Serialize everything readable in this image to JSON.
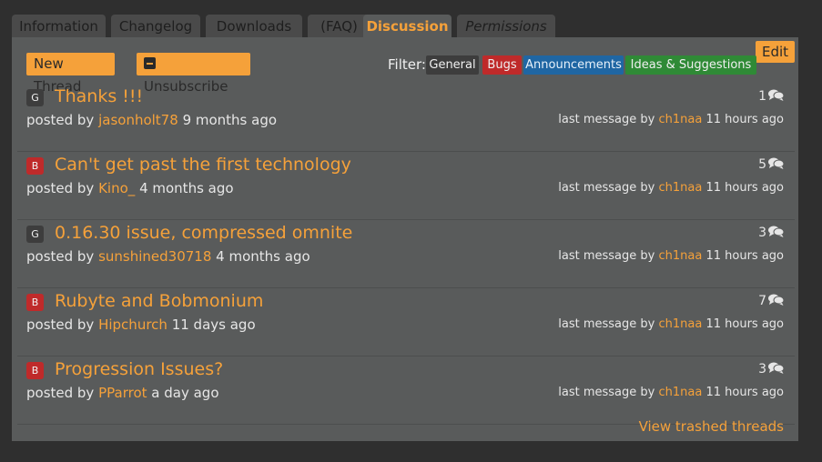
{
  "tabs": [
    {
      "label": "Information"
    },
    {
      "label": "Changelog"
    },
    {
      "label": "Downloads"
    },
    {
      "label": "(FAQ)"
    },
    {
      "label": "Discussion"
    },
    {
      "label": "Permissions"
    }
  ],
  "toolbar": {
    "edit_label": "Edit",
    "new_thread_label": "New Thread",
    "unsubscribe_label": "Unsubscribe",
    "filter_label": "Filter:",
    "filters": [
      "General",
      "Bugs",
      "Announcements",
      "Ideas & Suggestions"
    ]
  },
  "threads": [
    {
      "category": "G",
      "title": "Thanks !!!",
      "posted_prefix": "posted by",
      "author": "jasonholt78",
      "age": "9 months ago",
      "count": "1",
      "last_prefix": "last message by",
      "last_user": "ch1naa",
      "last_age": "11 hours ago"
    },
    {
      "category": "B",
      "title": "Can't get past the first technology",
      "posted_prefix": "posted by",
      "author": "Kino_",
      "age": "4 months ago",
      "count": "5",
      "last_prefix": "last message by",
      "last_user": "ch1naa",
      "last_age": "11 hours ago"
    },
    {
      "category": "G",
      "title": "0.16.30 issue, compressed omnite",
      "posted_prefix": "posted by",
      "author": "sunshined30718",
      "age": "4 months ago",
      "count": "3",
      "last_prefix": "last message by",
      "last_user": "ch1naa",
      "last_age": "11 hours ago"
    },
    {
      "category": "B",
      "title": "Rubyte and Bobmonium",
      "posted_prefix": "posted by",
      "author": "Hipchurch",
      "age": "11 days ago",
      "count": "7",
      "last_prefix": "last message by",
      "last_user": "ch1naa",
      "last_age": "11 hours ago"
    },
    {
      "category": "B",
      "title": "Progression Issues?",
      "posted_prefix": "posted by",
      "author": "PParrot",
      "age": "a day ago",
      "count": "3",
      "last_prefix": "last message by",
      "last_user": "ch1naa",
      "last_age": "11 hours ago"
    }
  ],
  "footer": {
    "trash_label": "View trashed threads"
  },
  "colors": {
    "accent": "#f5a13a",
    "panel": "#595b5b",
    "background": "#2f2f2f",
    "bugs": "#bf2a2a",
    "announcements": "#1f66a3",
    "ideas": "#2f8a36",
    "general": "#3d3d3d"
  },
  "icons": {
    "comment": "comment-bubbles-icon",
    "unsubscribe": "minus-square-icon"
  }
}
